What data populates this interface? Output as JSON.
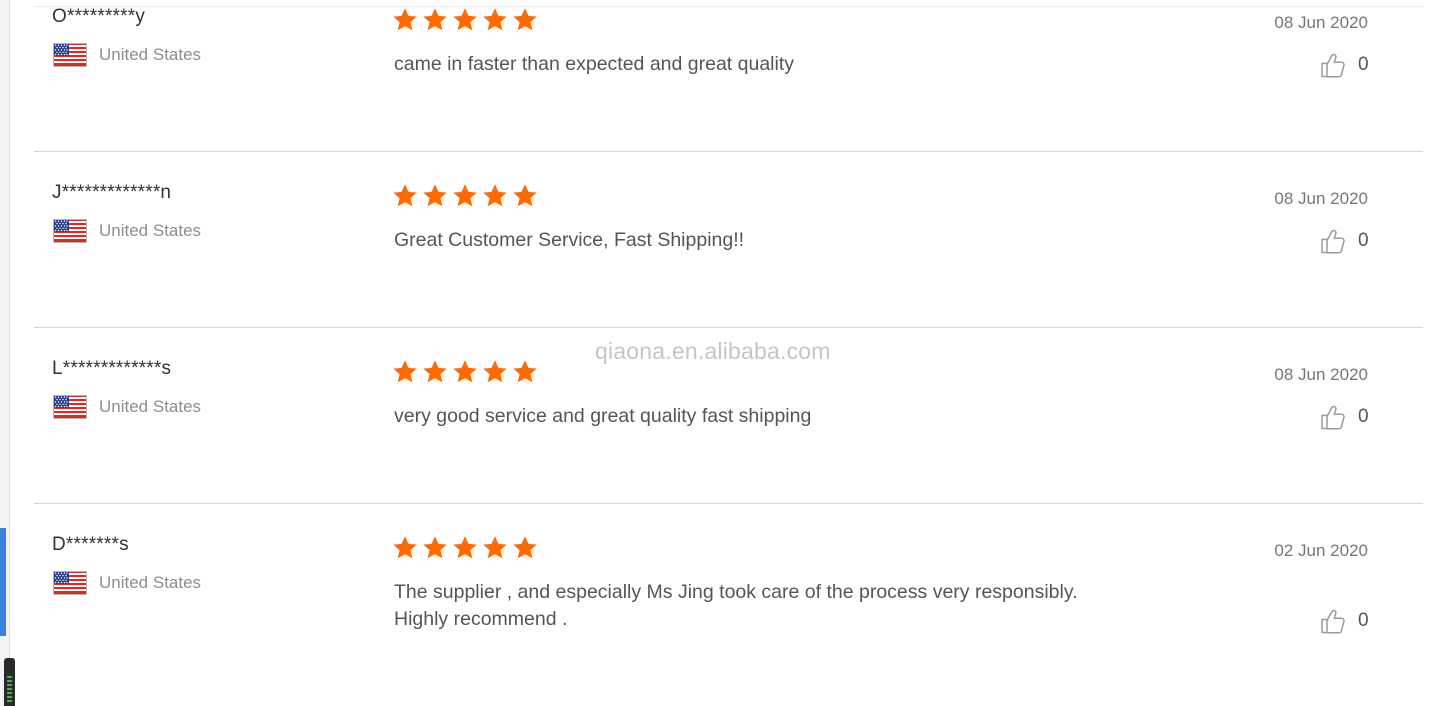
{
  "watermark": "qiaona.en.alibaba.com",
  "colors": {
    "star": "#ff6a00",
    "divider": "#d6d6d6",
    "accent_tab": "#3c7fe0"
  },
  "reviews": [
    {
      "buyer": "O*********y",
      "country": "United States",
      "flag_icon": "us-flag-icon",
      "rating": 5,
      "comment": "came in faster than expected and great quality",
      "date": "08 Jun 2020",
      "helpful_count": "0"
    },
    {
      "buyer": "J*************n",
      "country": "United States",
      "flag_icon": "us-flag-icon",
      "rating": 5,
      "comment": "Great Customer Service, Fast Shipping!!",
      "date": "08 Jun 2020",
      "helpful_count": "0"
    },
    {
      "buyer": "L*************s",
      "country": "United States",
      "flag_icon": "us-flag-icon",
      "rating": 5,
      "comment": "very good service and great quality fast shipping",
      "date": "08 Jun 2020",
      "helpful_count": "0"
    },
    {
      "buyer": "D*******s",
      "country": "United States",
      "flag_icon": "us-flag-icon",
      "rating": 5,
      "comment": "The supplier , and especially Ms Jing took care of the process very responsibly.\nHighly recommend .",
      "date": "02 Jun 2020",
      "helpful_count": "0"
    }
  ]
}
